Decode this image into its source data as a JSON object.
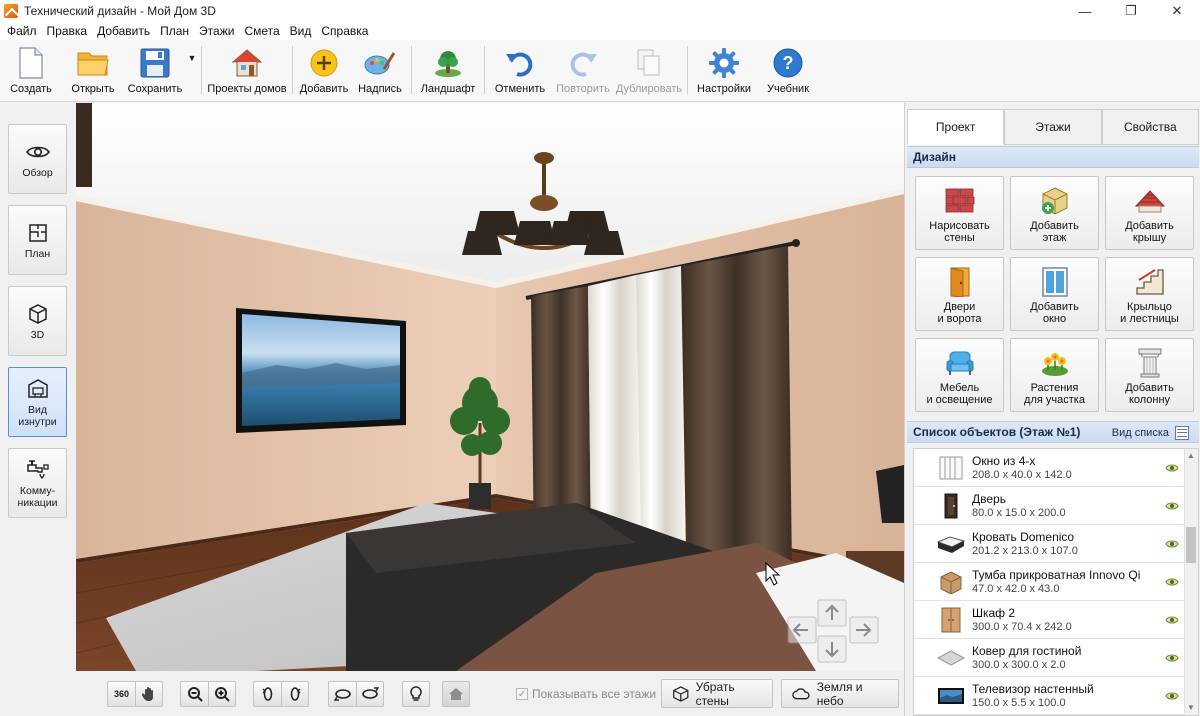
{
  "window": {
    "title": "Технический дизайн - Мой Дом 3D",
    "controls": {
      "minimize": "—",
      "maximize": "❐",
      "close": "✕"
    }
  },
  "menu": [
    "Файл",
    "Правка",
    "Добавить",
    "План",
    "Этажи",
    "Смета",
    "Вид",
    "Справка"
  ],
  "toolbar": {
    "create": "Создать",
    "open": "Открыть",
    "save": "Сохранить",
    "save_dropdown": "▼",
    "house_projects": "Проекты домов",
    "add": "Добавить",
    "caption": "Надпись",
    "landscape": "Ландшафт",
    "undo": "Отменить",
    "redo": "Повторить",
    "duplicate": "Дублировать",
    "settings": "Настройки",
    "tutorial": "Учебник"
  },
  "views": {
    "overview": "Обзор",
    "plan": "План",
    "three_d": "3D",
    "inside_1": "Вид",
    "inside_2": "изнутри",
    "comm_1": "Комму-",
    "comm_2": "никации"
  },
  "viewport_bar": {
    "rotate360": "360",
    "show_all_floors": "Показывать все этажи",
    "show_all_floors_checked": true,
    "remove_walls": "Убрать стены",
    "ground_sky": "Земля и небо"
  },
  "panel": {
    "tabs": [
      "Проект",
      "Этажи",
      "Свойства"
    ],
    "active_tab": "Проект",
    "design_header": "Дизайн",
    "design_buttons": [
      {
        "l1": "Нарисовать",
        "l2": "стены",
        "icon": "brick-wall-icon"
      },
      {
        "l1": "Добавить",
        "l2": "этаж",
        "icon": "add-floor-icon"
      },
      {
        "l1": "Добавить",
        "l2": "крышу",
        "icon": "roof-icon"
      },
      {
        "l1": "Двери",
        "l2": "и ворота",
        "icon": "door-icon"
      },
      {
        "l1": "Добавить",
        "l2": "окно",
        "icon": "window-icon"
      },
      {
        "l1": "Крыльцо",
        "l2": "и лестницы",
        "icon": "stairs-icon"
      },
      {
        "l1": "Мебель",
        "l2": "и освещение",
        "icon": "armchair-icon"
      },
      {
        "l1": "Растения",
        "l2": "для участка",
        "icon": "plant-icon"
      },
      {
        "l1": "Добавить",
        "l2": "колонну",
        "icon": "column-icon"
      }
    ],
    "objects_header": "Список объектов (Этаж №1)",
    "list_view": "Вид списка",
    "objects": [
      {
        "name": "Окно из 4-х",
        "dims": "208.0 x 40.0 x 142.0"
      },
      {
        "name": "Дверь",
        "dims": "80.0 x 15.0 x 200.0"
      },
      {
        "name": "Кровать Domenico",
        "dims": "201.2 x 213.0 x 107.0"
      },
      {
        "name": "Тумба прикроватная Innovo Qi",
        "dims": "47.0 x 42.0 x 43.0"
      },
      {
        "name": "Шкаф 2",
        "dims": "300.0 x 70.4 x 242.0"
      },
      {
        "name": "Ковер для гостиной",
        "dims": "300.0 x 300.0 x 2.0"
      },
      {
        "name": "Телевизор настенный",
        "dims": "150.0 x 5.5 x 100.0"
      }
    ]
  },
  "colors": {
    "wall": "#e8c6ae",
    "floor": "#6a3c22",
    "accent": "#3a7bd5",
    "header_bg": "#d6e4f5"
  }
}
